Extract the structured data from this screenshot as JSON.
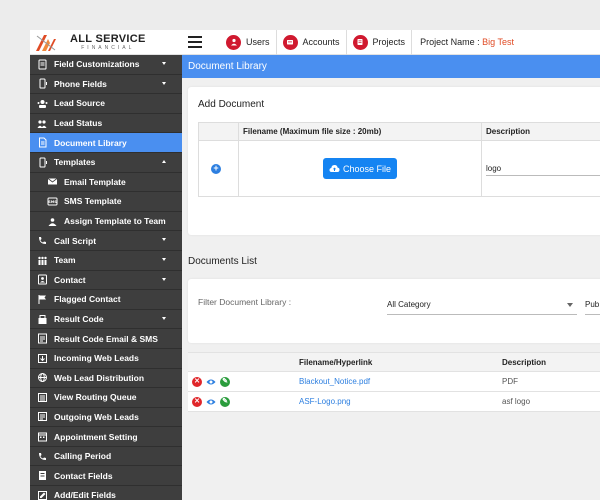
{
  "logo": {
    "title": "ALL SERVICE",
    "subtitle": "FINANCIAL"
  },
  "topnav": {
    "tabs": [
      {
        "label": "Users"
      },
      {
        "label": "Accounts"
      },
      {
        "label": "Projects"
      }
    ],
    "project_label": "Project Name :",
    "project_name": "Big Test"
  },
  "sidebar": {
    "items": [
      {
        "label": "Field Customizations",
        "icon": "form-icon",
        "caret": "down"
      },
      {
        "label": "Phone Fields",
        "icon": "phone-icon",
        "caret": "down"
      },
      {
        "label": "Lead Source",
        "icon": "source-icon"
      },
      {
        "label": "Lead Status",
        "icon": "status-icon"
      },
      {
        "label": "Document Library",
        "icon": "document-icon",
        "active": true
      },
      {
        "label": "Templates",
        "icon": "phone-icon",
        "caret": "up"
      },
      {
        "label": "Email Template",
        "icon": "email-icon",
        "sub": true
      },
      {
        "label": "SMS Template",
        "icon": "sms-icon",
        "sub": true
      },
      {
        "label": "Assign Template to Team",
        "icon": "team-assign-icon",
        "sub": true
      },
      {
        "label": "Call Script",
        "icon": "call-icon",
        "caret": "down"
      },
      {
        "label": "Team",
        "icon": "team-icon",
        "caret": "down"
      },
      {
        "label": "Contact",
        "icon": "contact-icon",
        "caret": "down"
      },
      {
        "label": "Flagged Contact",
        "icon": "flag-icon"
      },
      {
        "label": "Result Code",
        "icon": "result-icon",
        "caret": "down"
      },
      {
        "label": "Result Code Email & SMS",
        "icon": "result-mail-icon"
      },
      {
        "label": "Incoming Web Leads",
        "icon": "incoming-icon"
      },
      {
        "label": "Web Lead Distribution",
        "icon": "globe-icon"
      },
      {
        "label": "View Routing Queue",
        "icon": "queue-icon"
      },
      {
        "label": "Outgoing Web Leads",
        "icon": "outgoing-icon"
      },
      {
        "label": "Appointment Setting",
        "icon": "calendar-icon"
      },
      {
        "label": "Calling Period",
        "icon": "phone-call-icon"
      },
      {
        "label": "Contact Fields",
        "icon": "contact-fields-icon"
      },
      {
        "label": "Add/Edit Fields",
        "icon": "edit-fields-icon"
      }
    ]
  },
  "page": {
    "title": "Document Library"
  },
  "add_document": {
    "title": "Add Document",
    "col_filename": "Filename (Maximum file size : 20mb)",
    "col_description": "Description",
    "choose_file_label": "Choose File",
    "description_value": "logo"
  },
  "documents_list": {
    "title": "Documents List",
    "filter_label": "Filter Document Library :",
    "category_value": "All Category",
    "visibility_value": "Pub",
    "col_filename": "Filename/Hyperlink",
    "col_description": "Description",
    "rows": [
      {
        "filename": "Blackout_Notice.pdf",
        "description": "PDF"
      },
      {
        "filename": "ASF-Logo.png",
        "description": "asf logo"
      }
    ]
  },
  "colors": {
    "accent": "#4a8ff0",
    "sidebar": "#3e3e3e",
    "brand_red": "#d0192f",
    "button": "#1584f2"
  }
}
